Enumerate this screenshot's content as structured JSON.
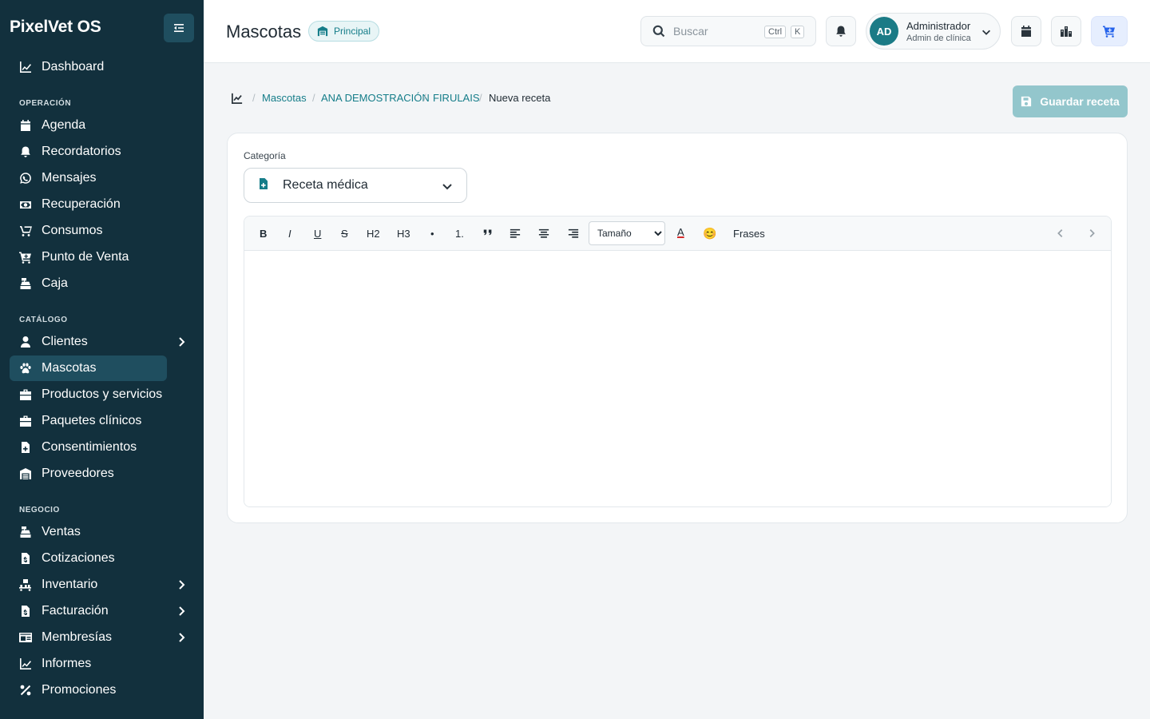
{
  "app": {
    "brand": "PixelVet OS"
  },
  "sidebar": {
    "sections": {
      "operacion": "OPERACIÓN",
      "catalogo": "CATÁLOGO",
      "negocio": "NEGOCIO"
    },
    "items": [
      {
        "label": "Dashboard",
        "icon": "chart-line-icon"
      },
      {
        "label": "Agenda",
        "icon": "calendar-icon"
      },
      {
        "label": "Recordatorios",
        "icon": "bell-icon"
      },
      {
        "label": "Mensajes",
        "icon": "whatsapp-icon"
      },
      {
        "label": "Recuperación",
        "icon": "money-icon"
      },
      {
        "label": "Consumos",
        "icon": "boxes-icon"
      },
      {
        "label": "Punto de Venta",
        "icon": "cart-icon"
      },
      {
        "label": "Caja",
        "icon": "cash-register-icon"
      },
      {
        "label": "Clientes",
        "icon": "user-icon"
      },
      {
        "label": "Mascotas",
        "icon": "paw-icon"
      },
      {
        "label": "Productos y servicios",
        "icon": "briefcase-icon"
      },
      {
        "label": "Paquetes clínicos",
        "icon": "package-icon"
      },
      {
        "label": "Consentimientos",
        "icon": "file-medical-icon"
      },
      {
        "label": "Proveedores",
        "icon": "warehouse-icon"
      },
      {
        "label": "Ventas",
        "icon": "cash-register-icon"
      },
      {
        "label": "Cotizaciones",
        "icon": "invoice-icon"
      },
      {
        "label": "Inventario",
        "icon": "dolly-icon"
      },
      {
        "label": "Facturación",
        "icon": "file-invoice-icon"
      },
      {
        "label": "Membresías",
        "icon": "id-card-icon"
      },
      {
        "label": "Informes",
        "icon": "chart-line-icon"
      },
      {
        "label": "Promociones",
        "icon": "percent-icon"
      }
    ]
  },
  "header": {
    "title": "Mascotas",
    "branch": "Principal",
    "search_placeholder": "Buscar",
    "kbd_ctrl": "Ctrl",
    "kbd_k": "K",
    "user": {
      "initials": "AD",
      "name": "Administrador",
      "role": "Admin de clínica"
    }
  },
  "breadcrumb": {
    "items": [
      "Mascotas",
      "ANA DEMOSTRACIÓN",
      "FIRULAIS"
    ],
    "current": "Nueva receta"
  },
  "actions": {
    "save_label": "Guardar receta"
  },
  "form": {
    "category_label": "Categoría",
    "category_value": "Receta médica",
    "editor": {
      "toolbar": [
        "B",
        "I",
        "U",
        "S",
        "H2",
        "H3",
        "•",
        "1."
      ],
      "size_label": "Tamaño",
      "color_label": "A",
      "emoji": "😊",
      "phrases_label": "Frases",
      "content": ""
    }
  },
  "colors": {
    "sidebar": "#12303d",
    "accent": "#157d89",
    "save_disabled": "#93c6cc",
    "cart": "#2563eb"
  }
}
